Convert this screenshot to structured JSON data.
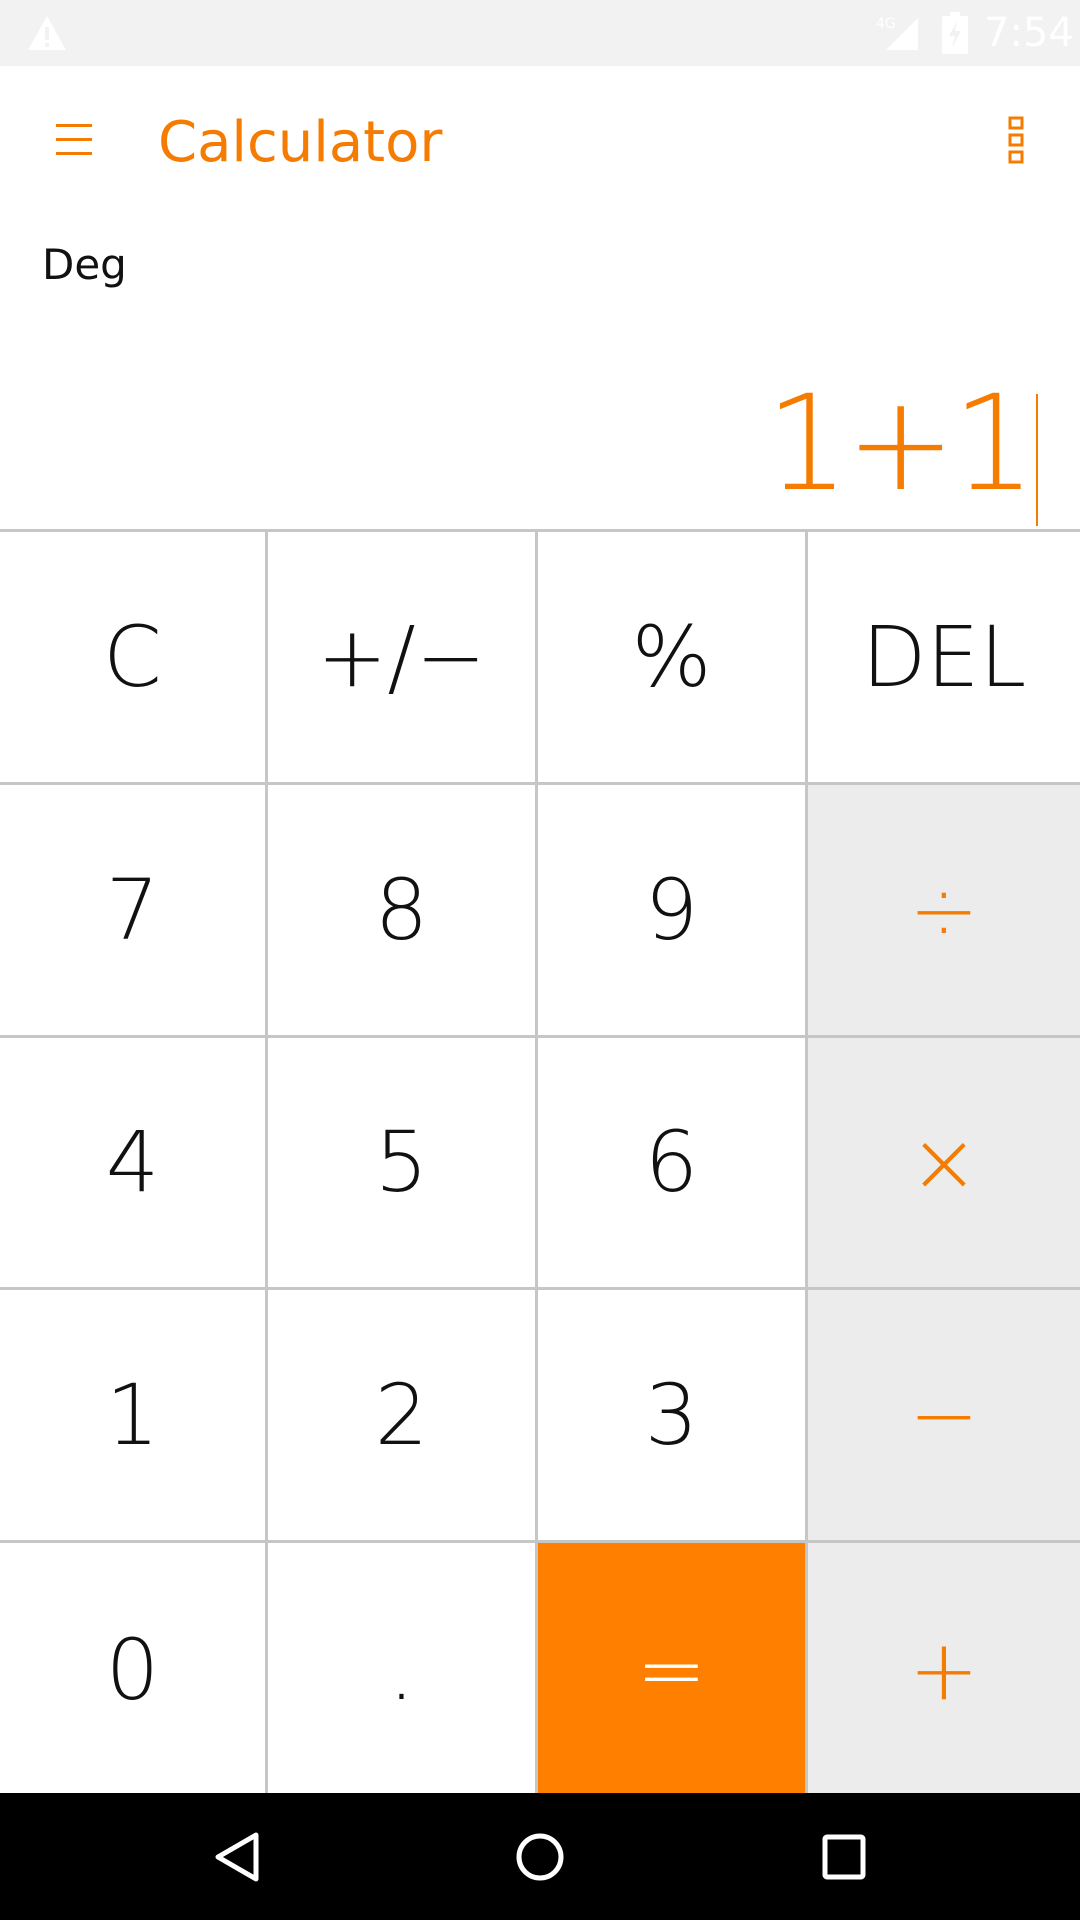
{
  "status_bar": {
    "network": "4G",
    "time": "7:54"
  },
  "app_bar": {
    "title": "Calculator"
  },
  "mode": "Deg",
  "display": {
    "expression": "1+1"
  },
  "keys": [
    {
      "label": "C",
      "type": "function"
    },
    {
      "label": "+/−",
      "type": "function"
    },
    {
      "label": "%",
      "type": "function"
    },
    {
      "label": "DEL",
      "type": "function"
    },
    {
      "label": "7",
      "type": "digit"
    },
    {
      "label": "8",
      "type": "digit"
    },
    {
      "label": "9",
      "type": "digit"
    },
    {
      "label": "÷",
      "type": "operator"
    },
    {
      "label": "4",
      "type": "digit"
    },
    {
      "label": "5",
      "type": "digit"
    },
    {
      "label": "6",
      "type": "digit"
    },
    {
      "label": "×",
      "type": "operator"
    },
    {
      "label": "1",
      "type": "digit"
    },
    {
      "label": "2",
      "type": "digit"
    },
    {
      "label": "3",
      "type": "digit"
    },
    {
      "label": "−",
      "type": "operator"
    },
    {
      "label": "0",
      "type": "digit"
    },
    {
      "label": ".",
      "type": "digit"
    },
    {
      "label": "=",
      "type": "equals"
    },
    {
      "label": "+",
      "type": "operator"
    }
  ],
  "colors": {
    "accent": "#f57c00",
    "equals_bg": "#ff8000",
    "operator_bg": "#ececec",
    "grid_line": "#c6c6c6"
  },
  "icons": {
    "warning": "warning-triangle-icon",
    "signal": "signal-icon",
    "battery": "battery-charging-icon",
    "menu": "menu-icon",
    "overflow": "more-vert-icon",
    "back": "back-triangle-icon",
    "home": "home-circle-icon",
    "recents": "recents-square-icon"
  }
}
